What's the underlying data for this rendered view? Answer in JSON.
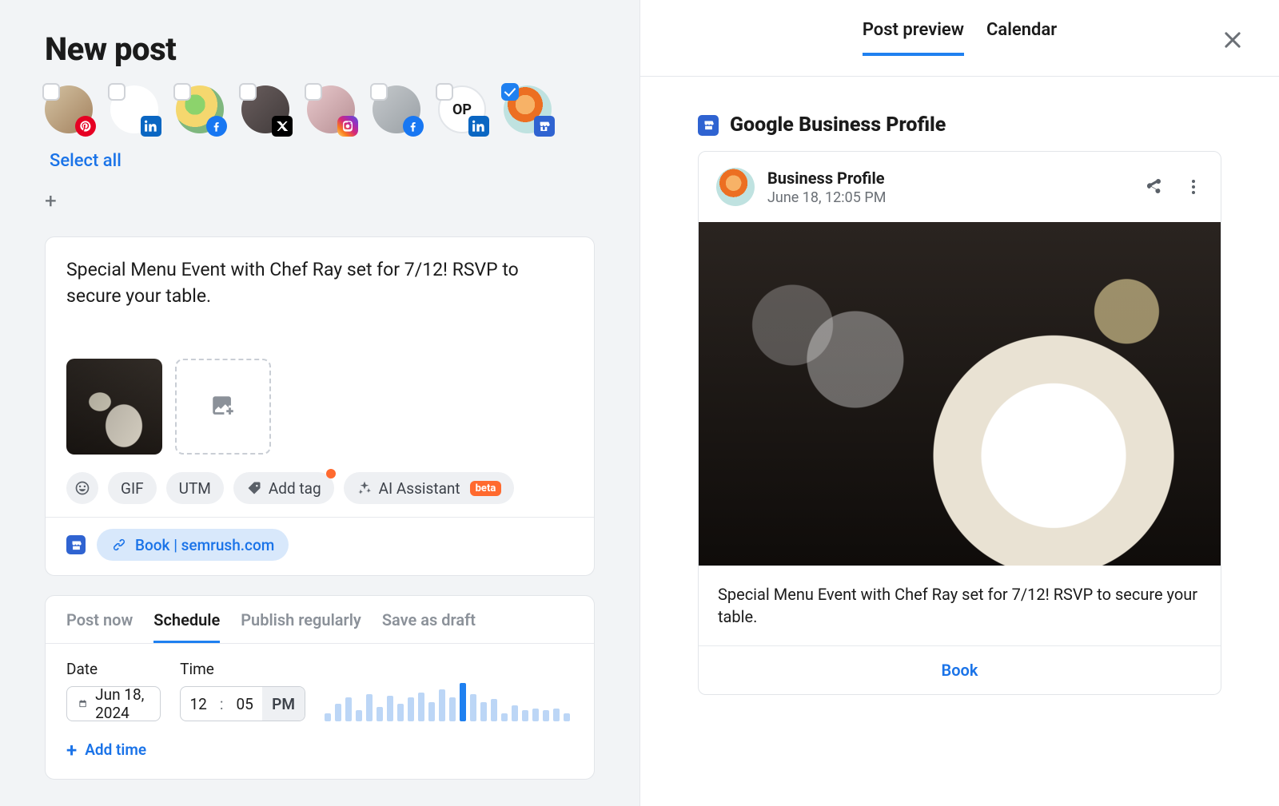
{
  "title": "New post",
  "select_all": "Select all",
  "accounts": [
    {
      "network": "pinterest",
      "selected": false
    },
    {
      "network": "linkedin",
      "selected": false
    },
    {
      "network": "facebook",
      "selected": false
    },
    {
      "network": "x",
      "selected": false
    },
    {
      "network": "instagram",
      "selected": false
    },
    {
      "network": "facebook",
      "selected": false
    },
    {
      "network": "linkedin",
      "selected": false,
      "label": "OP"
    },
    {
      "network": "gbp",
      "selected": true
    }
  ],
  "compose": {
    "text": "Special Menu Event with Chef Ray set for 7/12! RSVP to secure your table."
  },
  "chips": {
    "gif": "GIF",
    "utm": "UTM",
    "add_tag": "Add tag",
    "ai": "AI Assistant",
    "beta": "beta"
  },
  "link": {
    "label": "Book",
    "domain": "semrush.com"
  },
  "schedule": {
    "tabs": {
      "post_now": "Post now",
      "schedule": "Schedule",
      "regularly": "Publish regularly",
      "draft": "Save as draft"
    },
    "date_label": "Date",
    "time_label": "Time",
    "date": "Jun 18, 2024",
    "time_hh": "12",
    "time_mm": "05",
    "time_ampm": "PM",
    "add_time": "Add time",
    "histogram": [
      10,
      22,
      30,
      14,
      34,
      18,
      32,
      22,
      30,
      36,
      24,
      40,
      30,
      48,
      34,
      24,
      28,
      10,
      20,
      14,
      16,
      14,
      16,
      10
    ]
  },
  "right": {
    "tabs": {
      "preview": "Post preview",
      "calendar": "Calendar"
    },
    "gbp_title": "Google Business Profile",
    "card": {
      "name": "Business Profile",
      "time": "June 18, 12:05 PM",
      "caption": "Special Menu Event with Chef Ray set for 7/12! RSVP to secure your table.",
      "cta": "Book"
    }
  }
}
